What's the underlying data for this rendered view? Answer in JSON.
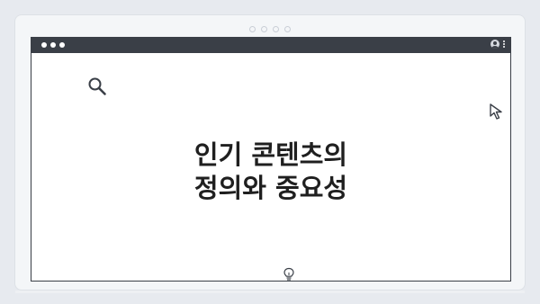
{
  "window": {
    "controls": [
      "close",
      "minimize",
      "maximize"
    ],
    "right_icons": [
      "profile-icon",
      "kebab-menu-icon"
    ]
  },
  "content": {
    "headline_line1": "인기 콘텐츠의",
    "headline_line2": "정의와 중요성"
  },
  "icons": {
    "top_left": "search-icon",
    "top_right": "cursor-pointer-icon",
    "bottom_center": "lightbulb-icon"
  },
  "colors": {
    "background": "#e7eaef",
    "titlebar": "#3a3f47",
    "page": "#ffffff",
    "text": "#1f1f1f"
  }
}
